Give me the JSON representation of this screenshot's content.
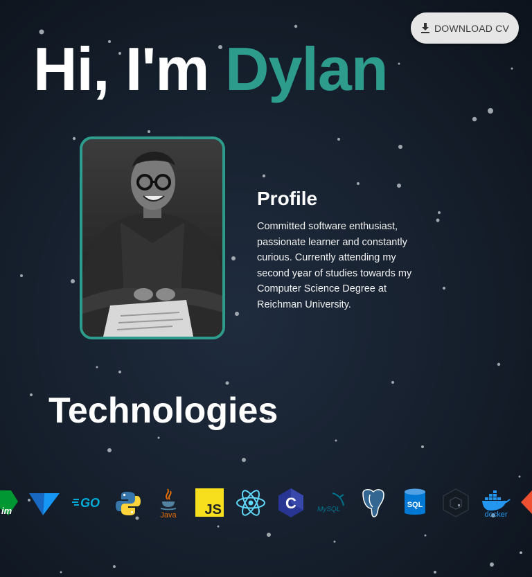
{
  "header": {
    "greeting": "Hi, I'm ",
    "name": "Dylan",
    "download_label": "DOWNLOAD CV"
  },
  "colors": {
    "accent": "#2e9c8c",
    "background": "#17212f",
    "button_bg": "#e6e6e6"
  },
  "profile": {
    "heading": "Profile",
    "text": "Committed software enthusiast, passionate learner and constantly curious. Currently attending my second year of studies towards my Computer Science Degree at Reichman University."
  },
  "technologies": {
    "heading": "Technologies",
    "icons": [
      {
        "name": "vim-icon",
        "label": "im"
      },
      {
        "name": "vuetify-icon",
        "label": ""
      },
      {
        "name": "go-icon",
        "label": "GO"
      },
      {
        "name": "python-icon",
        "label": ""
      },
      {
        "name": "java-icon",
        "label": "Java"
      },
      {
        "name": "javascript-icon",
        "label": "JS"
      },
      {
        "name": "react-icon",
        "label": ""
      },
      {
        "name": "c-icon",
        "label": "C"
      },
      {
        "name": "mysql-icon",
        "label": "MySQL"
      },
      {
        "name": "postgresql-icon",
        "label": ""
      },
      {
        "name": "sql-icon",
        "label": "SQL"
      },
      {
        "name": "unity-icon",
        "label": ""
      },
      {
        "name": "docker-icon",
        "label": "docker"
      },
      {
        "name": "git-icon",
        "label": ""
      }
    ]
  }
}
